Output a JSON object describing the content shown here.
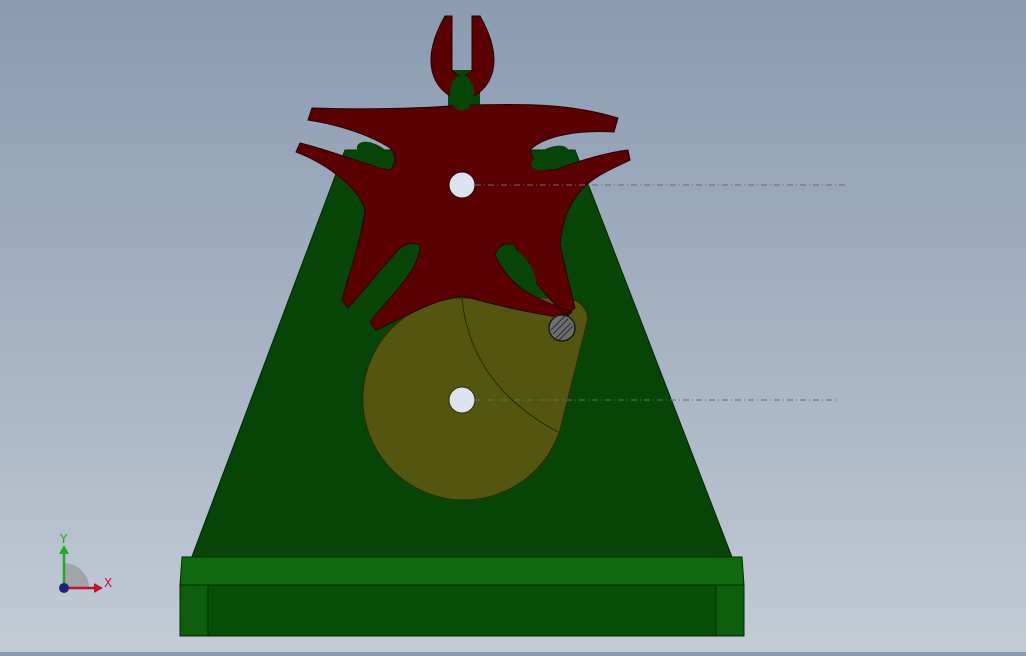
{
  "triad": {
    "x_label": "X",
    "y_label": "Y",
    "x_color": "#c8102e",
    "y_color": "#1faa1f",
    "origin_color": "#1a237e"
  },
  "colors": {
    "background_top": "#8a9bb1",
    "background_bottom": "#c3cbd5",
    "frame_plate": "#074507",
    "base_top_face": "#0f6a0f",
    "base_front_face": "#074f07",
    "geneva_wheel": "#5a0000",
    "drive_disk": "#54560f",
    "drive_pin": "#6e6e6e",
    "hole": "#dbe3ee",
    "centerline": "#6b6b6b"
  },
  "objects": {
    "frame": "support-plate",
    "base": "base-block",
    "driven": "geneva-wheel",
    "driver": "drive-crank-disk",
    "pin": "drive-pin"
  }
}
